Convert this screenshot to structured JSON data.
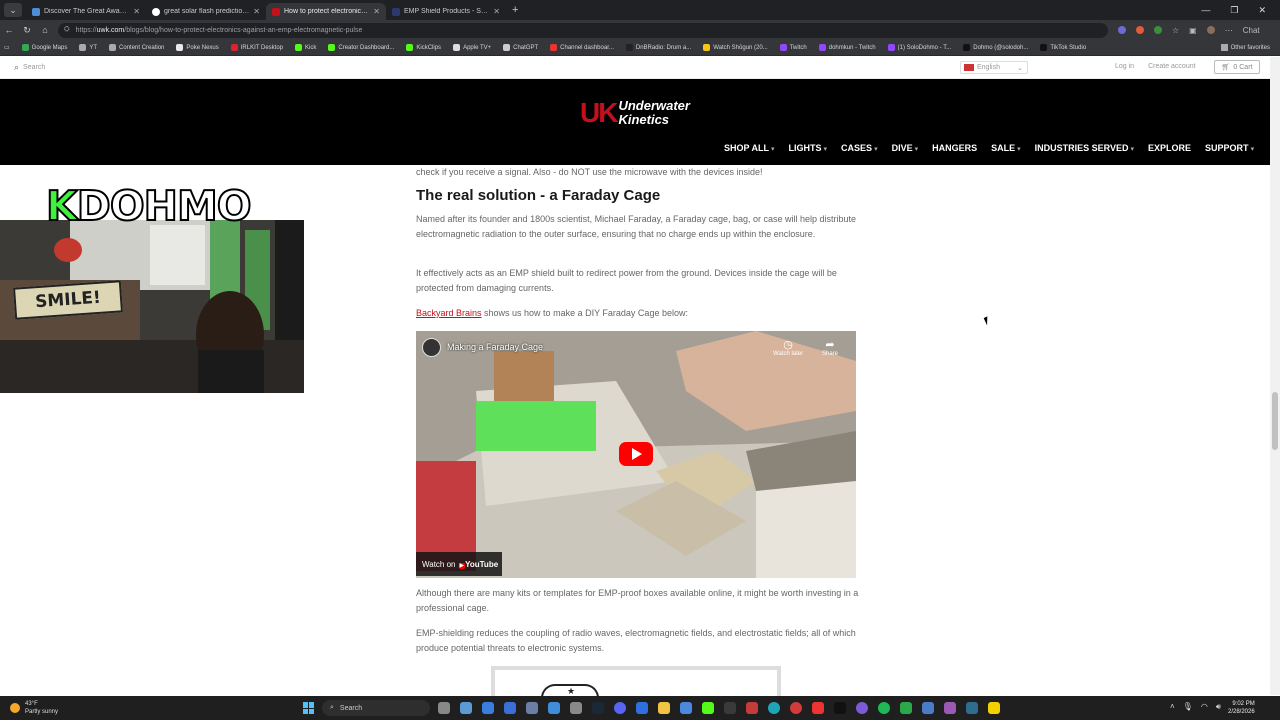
{
  "browser": {
    "tabs": [
      {
        "title": "Discover The Great Awakening M...",
        "color": "#4d8fd6",
        "active": false
      },
      {
        "title": "great solar flash prediction - Goog",
        "color": "#ffffff",
        "active": false
      },
      {
        "title": "How to protect electronics agains...",
        "color": "#c3101b",
        "active": true
      },
      {
        "title": "EMP Shield Products - Signature S",
        "color": "#2a3a6a",
        "active": false
      }
    ],
    "url_prefix": "https://",
    "url_host": "uwk.com",
    "url_path": "/blogs/blog/how-to-protect-electronics-against-an-emp-electromagnetic-pulse",
    "bookmarks": [
      "Google Maps",
      "YT",
      "Content Creation",
      "Poke Nexus",
      "IRLKIT Desktop",
      "Kick",
      "Creator Dashboard...",
      "KickClips",
      "Apple TV+",
      "ChatGPT",
      "Channel dashboar...",
      "DnBRadio: Drum a...",
      "Watch Shōgun (20...",
      "Twitch",
      "dohmkun - Twitch",
      "(1) SoloDohmo - T...",
      "Dohmo (@solodoh...",
      "TikTok Studio"
    ],
    "other_favorites": "Other favorites",
    "chat_label": "Chat"
  },
  "site": {
    "search_placeholder": "Search",
    "language": "English",
    "login": "Log in",
    "create_account": "Create account",
    "cart": "0 Cart",
    "logo_mark": "UK",
    "logo_line1": "Underwater",
    "logo_line2": "Kinetics",
    "menu": [
      {
        "label": "SHOP ALL",
        "caret": true
      },
      {
        "label": "LIGHTS",
        "caret": true
      },
      {
        "label": "CASES",
        "caret": true
      },
      {
        "label": "DIVE",
        "caret": true
      },
      {
        "label": "HANGERS",
        "caret": false
      },
      {
        "label": "SALE",
        "caret": true
      },
      {
        "label": "INDUSTRIES SERVED",
        "caret": true
      },
      {
        "label": "EXPLORE",
        "caret": false
      },
      {
        "label": "SUPPORT",
        "caret": true
      }
    ]
  },
  "article": {
    "cut_line": "check if you receive a signal. Also - do NOT use the microwave with the devices inside!",
    "heading": "The real solution - a Faraday Cage",
    "p1": "Named after its founder and 1800s scientist, Michael Faraday, a Faraday cage, bag, or case will help distribute electromagnetic radiation to the outer surface, ensuring that no charge ends up within the enclosure.",
    "p2": "It effectively acts as an EMP shield built to redirect power from the ground. Devices inside the cage will be protected from damaging currents.",
    "p3_link": "Backyard Brains",
    "p3_rest": " shows us how to make a DIY Faraday Cage below:",
    "p4": "Although there are many kits or templates for EMP-proof boxes available online, it might be worth investing in a professional cage.",
    "p5": "EMP-shielding reduces the coupling of radio waves, electromagnetic fields, and electrostatic fields; all of which produce potential threats to electronic systems."
  },
  "video": {
    "title": "Making a Faraday Cage",
    "watch_later": "Watch later",
    "share": "Share",
    "watch_on": "Watch on",
    "youtube": "YouTube"
  },
  "overlay": {
    "k": "K",
    "name": "DOHMO",
    "sign": "SMILE!"
  },
  "taskbar": {
    "temp": "43°F",
    "condition": "Partly sunny",
    "search": "Search",
    "time": "9:02 PM",
    "date": "2/28/2026"
  }
}
